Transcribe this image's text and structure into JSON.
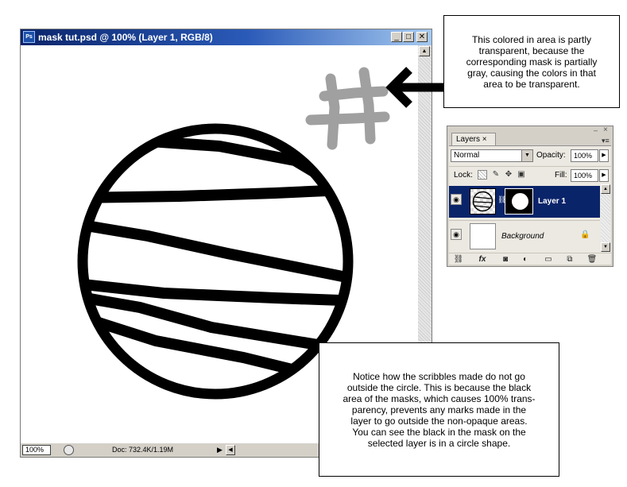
{
  "document_window": {
    "title": "mask tut.psd @ 100% (Layer 1, RGB/8)",
    "app_icon_label": "Ps",
    "buttons": {
      "minimize": "_",
      "maximize": "□",
      "close": "✕"
    },
    "status": {
      "zoom": "100%",
      "doc_size": "Doc: 732.4K/1.19M"
    }
  },
  "annotations": {
    "top": "This colored in area is partly\ntransparent, because the\ncorresponding mask is partially\ngray, causing the colors in that\narea to be transparent.",
    "bottom": "Notice how the scribbles made do not go\noutside the circle. This is because the black\narea of the masks, which causes 100% trans-\nparency, prevents any marks made in the\nlayer to go outside the non-opaque areas.\nYou can see the black in the mask on the\nselected layer is in a circle shape."
  },
  "layers_panel": {
    "tab_label": "Layers ×",
    "blend_mode": "Normal",
    "opacity_label": "Opacity:",
    "opacity_value": "100%",
    "lock_label": "Lock:",
    "fill_label": "Fill:",
    "fill_value": "100%",
    "layers": [
      {
        "name": "Layer 1",
        "selected": true,
        "has_mask": true
      },
      {
        "name": "Background",
        "selected": false,
        "locked": true
      }
    ],
    "footer_fx_label": "fx"
  },
  "colors": {
    "titlebar_start": "#0a246a",
    "titlebar_end": "#a6caf0",
    "selected_layer": "#0a246a",
    "partial_transparent_mark": "#a0a0a0",
    "panel_bg": "#d4d0c8"
  }
}
